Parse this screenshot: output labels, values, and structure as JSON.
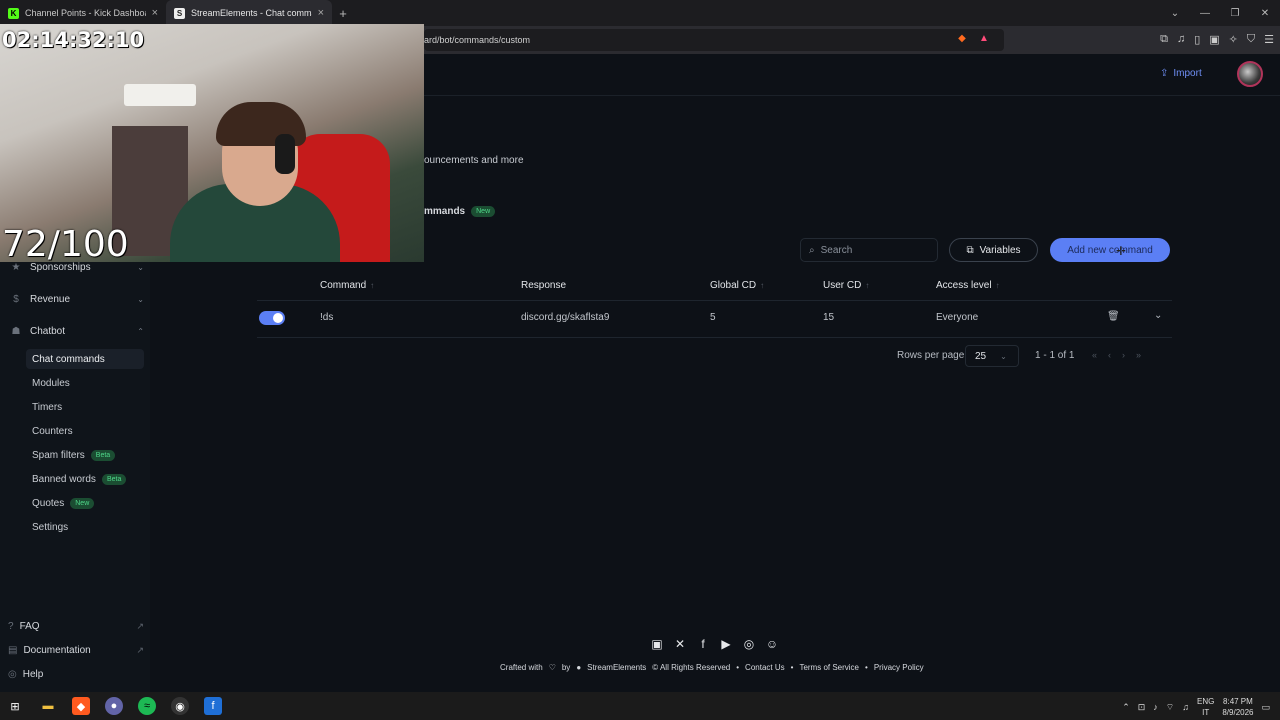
{
  "browser": {
    "tabs": [
      {
        "title": "Channel Points - Kick Dashboard",
        "active": false
      },
      {
        "title": "StreamElements - Chat commands",
        "active": true
      }
    ],
    "url": "ard/bot/commands/custom"
  },
  "webcam": {
    "timer": "02:14:32:10",
    "counter": "72/100"
  },
  "header": {
    "import_label": "Import"
  },
  "page": {
    "subtitle_fragment": "ouncements and more",
    "tab_label": "mmands",
    "tab_badge": "New"
  },
  "sidebar": {
    "sections": [
      {
        "label": "Sponsorships",
        "icon": "star-icon"
      },
      {
        "label": "Revenue",
        "icon": "dollar-icon"
      },
      {
        "label": "Chatbot",
        "icon": "robot-icon"
      }
    ],
    "chatbot_items": [
      {
        "label": "Chat commands",
        "active": true,
        "badge": ""
      },
      {
        "label": "Modules",
        "active": false,
        "badge": ""
      },
      {
        "label": "Timers",
        "active": false,
        "badge": ""
      },
      {
        "label": "Counters",
        "active": false,
        "badge": ""
      },
      {
        "label": "Spam filters",
        "active": false,
        "badge": "Beta"
      },
      {
        "label": "Banned words",
        "active": false,
        "badge": "Beta"
      },
      {
        "label": "Quotes",
        "active": false,
        "badge": "New"
      },
      {
        "label": "Settings",
        "active": false,
        "badge": ""
      }
    ],
    "footer": [
      {
        "label": "FAQ",
        "icon": "help-circle-icon"
      },
      {
        "label": "Documentation",
        "icon": "book-icon"
      },
      {
        "label": "Help",
        "icon": "lifebuoy-icon"
      }
    ]
  },
  "toolbar": {
    "search_placeholder": "Search",
    "variables_label": "Variables",
    "add_label": "Add new command"
  },
  "table": {
    "columns": [
      "Command",
      "Response",
      "Global CD",
      "User CD",
      "Access level"
    ],
    "rows": [
      {
        "enabled": true,
        "command": "!ds",
        "response": "discord.gg/skaflsta9",
        "global_cd": "5",
        "user_cd": "15",
        "access": "Everyone"
      }
    ]
  },
  "pagination": {
    "rows_per_page_label": "Rows per page",
    "rows_per_page": "25",
    "range": "1 - 1 of 1"
  },
  "footer": {
    "crafted_with": "Crafted with",
    "by": "by",
    "brand": "StreamElements",
    "rights": "© All Rights Reserved",
    "links": [
      "Contact Us",
      "Terms of Service",
      "Privacy Policy"
    ]
  },
  "taskbar": {
    "lang_top": "ENG",
    "lang_bottom": "IT",
    "time": "8:47 PM",
    "date": "8/9/2026"
  },
  "colors": {
    "accent": "#5b7ff5",
    "background": "#0d1117",
    "badge_green": "#4fd88a"
  }
}
